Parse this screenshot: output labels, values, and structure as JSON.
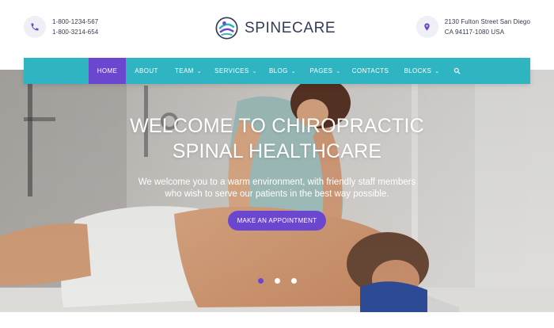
{
  "header": {
    "phones": [
      "1-800-1234-567",
      "1-800-3214-654"
    ],
    "address": [
      "2130 Fulton Street San Diego",
      "CA 94117-1080 USA"
    ],
    "logo_text": "SPINECARE",
    "icons": {
      "phone": "phone-icon",
      "location": "location-pin-icon",
      "logo": "spine-logo-icon"
    }
  },
  "nav": {
    "items": [
      {
        "label": "HOME",
        "active": true,
        "dropdown": false
      },
      {
        "label": "ABOUT",
        "active": false,
        "dropdown": false
      },
      {
        "label": "TEAM",
        "active": false,
        "dropdown": true
      },
      {
        "label": "SERVICES",
        "active": false,
        "dropdown": true
      },
      {
        "label": "BLOG",
        "active": false,
        "dropdown": true
      },
      {
        "label": "PAGES",
        "active": false,
        "dropdown": true
      },
      {
        "label": "CONTACTS",
        "active": false,
        "dropdown": false
      },
      {
        "label": "BLOCKS",
        "active": false,
        "dropdown": true
      }
    ],
    "search_icon": "search-icon"
  },
  "hero": {
    "title_line1": "WELCOME TO CHIROPRACTIC",
    "title_line2": "SPINAL HEALTHCARE",
    "subtitle_line1": "We welcome you to a warm environment, with friendly staff members",
    "subtitle_line2": "who wish to serve our patients in the best way possible.",
    "cta_label": "MAKE AN APPOINTMENT",
    "slide_count": 3,
    "active_slide": 1
  },
  "colors": {
    "accent": "#6b47cf",
    "nav_bg": "#2fb4c2",
    "text_dark": "#333b58"
  }
}
